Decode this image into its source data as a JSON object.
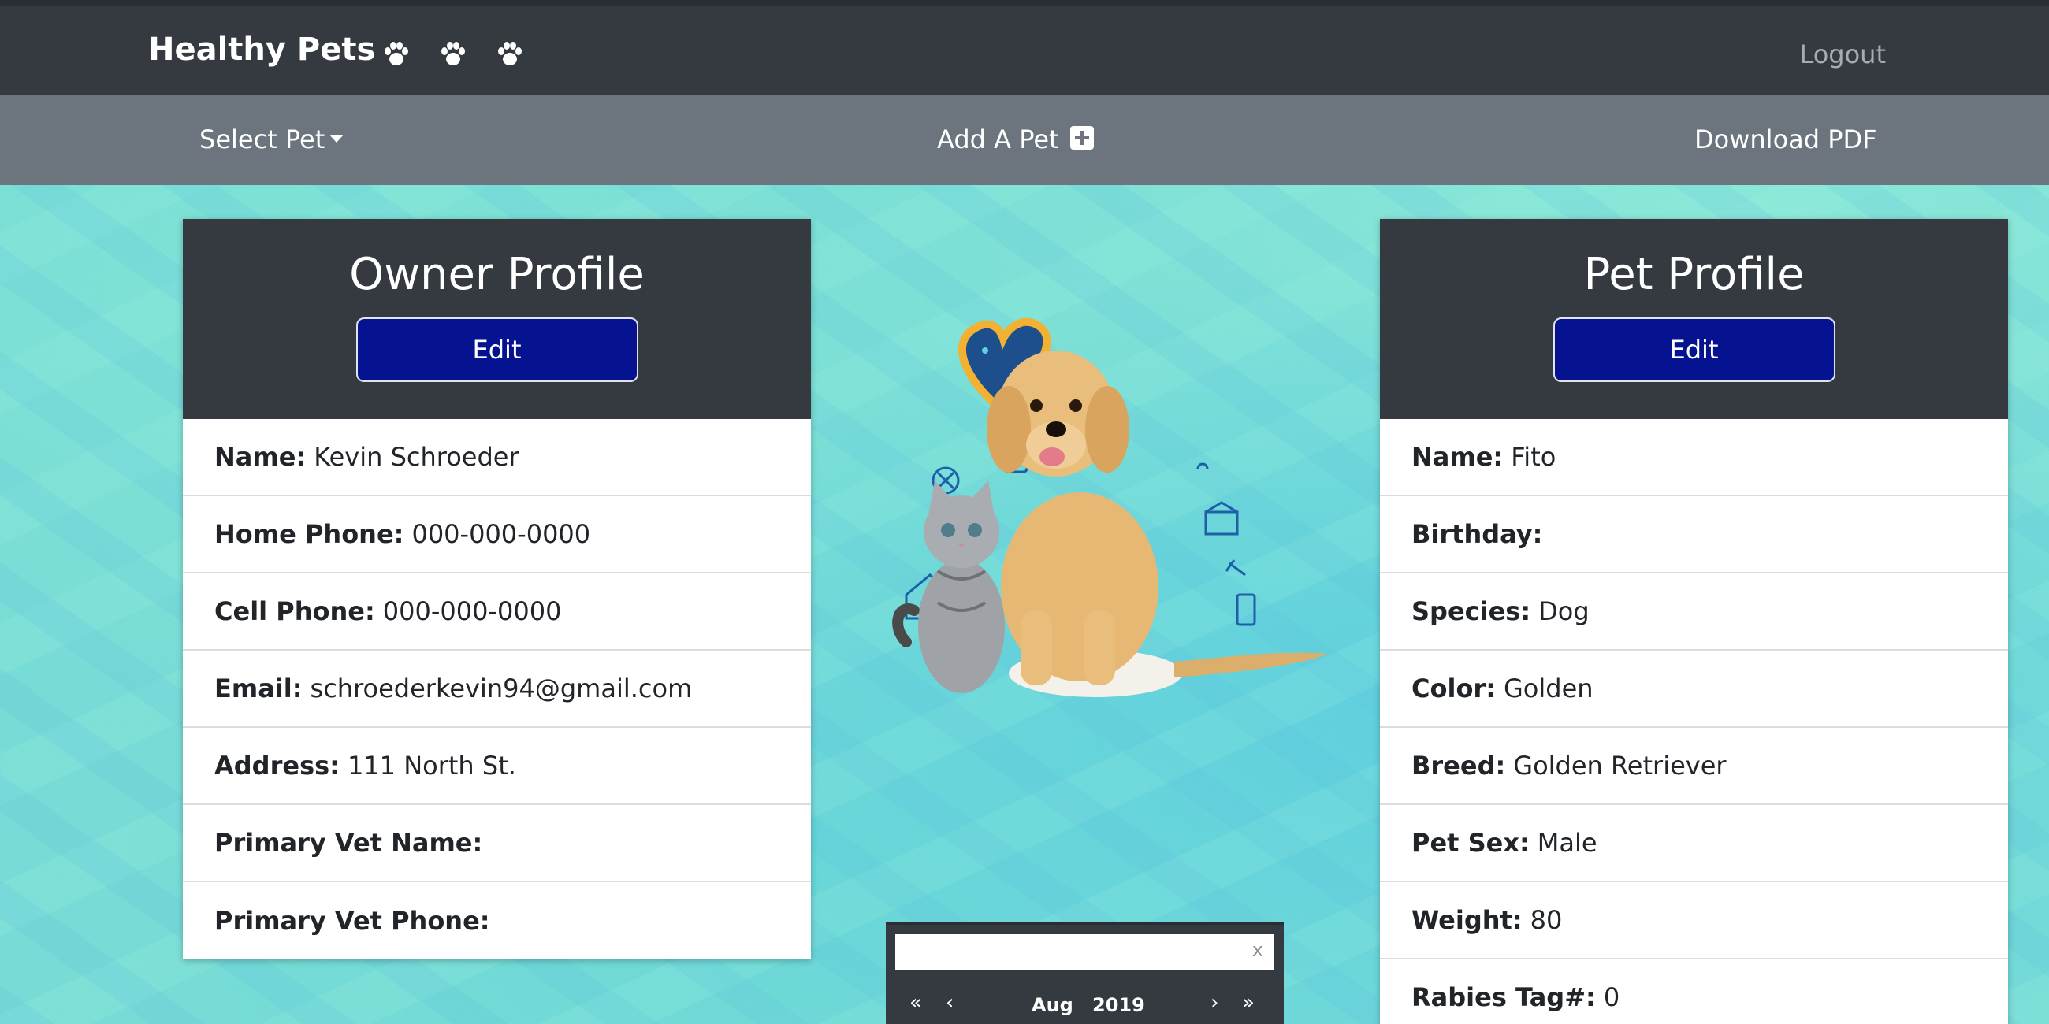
{
  "header": {
    "brand": "Healthy Pets",
    "paw_icons": [
      "paw-icon",
      "paw-icon",
      "paw-icon"
    ],
    "logout": "Logout"
  },
  "subnav": {
    "select_pet": "Select Pet",
    "add_pet": "Add A Pet",
    "download_pdf": "Download PDF"
  },
  "owner": {
    "title": "Owner Profile",
    "edit": "Edit",
    "fields": [
      {
        "label": "Name:",
        "value": "Kevin Schroeder"
      },
      {
        "label": "Home Phone:",
        "value": "000-000-0000"
      },
      {
        "label": "Cell Phone:",
        "value": "000-000-0000"
      },
      {
        "label": "Email:",
        "value": "schroederkevin94@gmail.com"
      },
      {
        "label": "Address:",
        "value": "111 North St."
      },
      {
        "label": "Primary Vet Name:",
        "value": ""
      },
      {
        "label": "Primary Vet Phone:",
        "value": ""
      }
    ]
  },
  "pet": {
    "title": "Pet Profile",
    "edit": "Edit",
    "fields": [
      {
        "label": "Name:",
        "value": "Fito"
      },
      {
        "label": "Birthday:",
        "value": ""
      },
      {
        "label": "Species:",
        "value": "Dog"
      },
      {
        "label": "Color:",
        "value": "Golden"
      },
      {
        "label": "Breed:",
        "value": "Golden Retriever"
      },
      {
        "label": "Pet Sex:",
        "value": "Male"
      },
      {
        "label": "Weight:",
        "value": "80"
      },
      {
        "label": "Rabies Tag#:",
        "value": "0"
      }
    ]
  },
  "datepicker": {
    "clear": "x",
    "first": "«",
    "prev": "‹",
    "month": "Aug",
    "year": "2019",
    "next": "›",
    "last": "»"
  },
  "colors": {
    "navbar": "#343a40",
    "subnav": "#6c757d",
    "edit_button": "#061391",
    "background": "#78dcd6"
  }
}
